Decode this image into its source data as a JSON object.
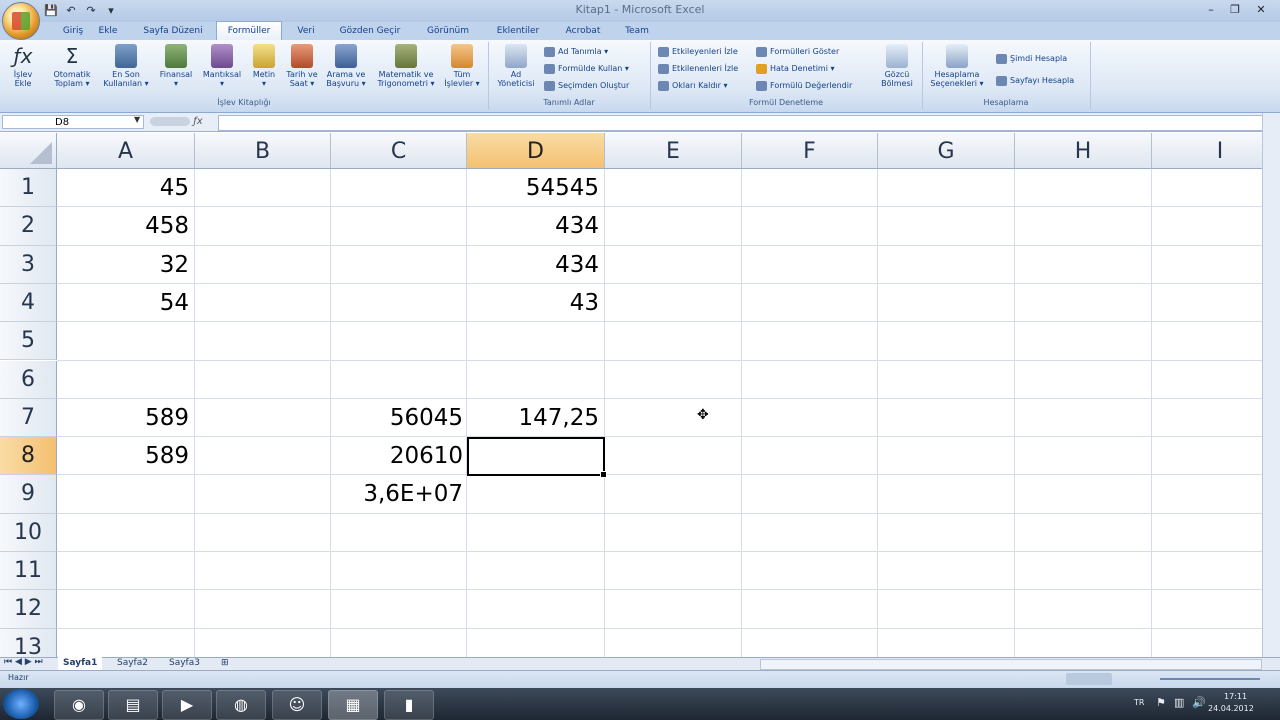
{
  "title_bar": {
    "title": "Kitap1 - Microsoft Excel",
    "qat": [
      "💾",
      "↶",
      "↷",
      "▾"
    ],
    "window_controls": [
      "–",
      "❐",
      "✕"
    ]
  },
  "tabs": [
    "Giriş",
    "Ekle",
    "Sayfa Düzeni",
    "Formüller",
    "Veri",
    "Gözden Geçir",
    "Görünüm",
    "Eklentiler",
    "Acrobat",
    "Team"
  ],
  "active_tab": "Formüller",
  "ribbon": {
    "islev_buttons": [
      {
        "label": "İşlev\nEkle",
        "icon": "function-icon"
      },
      {
        "label": "Otomatik\nToplam ▾",
        "icon": "sigma-icon"
      },
      {
        "label": "En Son\nKullanılan ▾",
        "icon": "book-icon"
      },
      {
        "label": "Finansal\n▾",
        "icon": "book-icon"
      },
      {
        "label": "Mantıksal\n▾",
        "icon": "book-icon"
      },
      {
        "label": "Metin\n▾",
        "icon": "book-icon"
      },
      {
        "label": "Tarih ve\nSaat ▾",
        "icon": "book-icon"
      },
      {
        "label": "Arama ve\nBaşvuru ▾",
        "icon": "book-icon"
      },
      {
        "label": "Matematik ve\nTrigonometri ▾",
        "icon": "book-icon"
      },
      {
        "label": "Tüm\nİşlevler ▾",
        "icon": "book-icon"
      }
    ],
    "islev_group_label": "İşlev Kitaplığı",
    "ad_yoneticisi": "Ad\nYöneticisi",
    "tanimli_items": [
      "Ad Tanımla ▾",
      "Formülde Kullan ▾",
      "Seçimden Oluştur"
    ],
    "tanimli_group_label": "Tanımlı Adlar",
    "denetleme_left": [
      "Etkileyenleri İzle",
      "Etkilenenleri İzle",
      "Okları Kaldır ▾"
    ],
    "denetleme_right": [
      "Formülleri Göster",
      "Hata Denetimi ▾",
      "Formülü Değerlendir"
    ],
    "gozcu": "Gözcü\nBölmesi",
    "denetleme_group_label": "Formül Denetleme",
    "hesaplama_btn": "Hesaplama\nSeçenekleri ▾",
    "hesaplama_items": [
      "Şimdi Hesapla",
      "Sayfayı Hesapla"
    ],
    "hesaplama_group_label": "Hesaplama"
  },
  "name_box": "D8",
  "formula": "",
  "columns": [
    "A",
    "B",
    "C",
    "D",
    "E",
    "F",
    "G",
    "H",
    "I"
  ],
  "selected_column": "D",
  "rows": [
    "1",
    "2",
    "3",
    "4",
    "5",
    "6",
    "7",
    "8",
    "9",
    "10",
    "11",
    "12",
    "13"
  ],
  "selected_row": "8",
  "cells": {
    "A1": "45",
    "D1": "54545",
    "A2": "458",
    "D2": "434",
    "A3": "32",
    "D3": "434",
    "A4": "54",
    "D4": "43",
    "A7": "589",
    "C7": "56045",
    "D7": "147,25",
    "A8": "589",
    "C8": "20610",
    "C9": "3,6E+07"
  },
  "sheets": [
    "Sayfa1",
    "Sayfa2",
    "Sayfa3"
  ],
  "active_sheet": "Sayfa1",
  "status": "Hazır",
  "tray": {
    "lang": "TR",
    "time": "17:11",
    "date": "24.04.2012"
  }
}
